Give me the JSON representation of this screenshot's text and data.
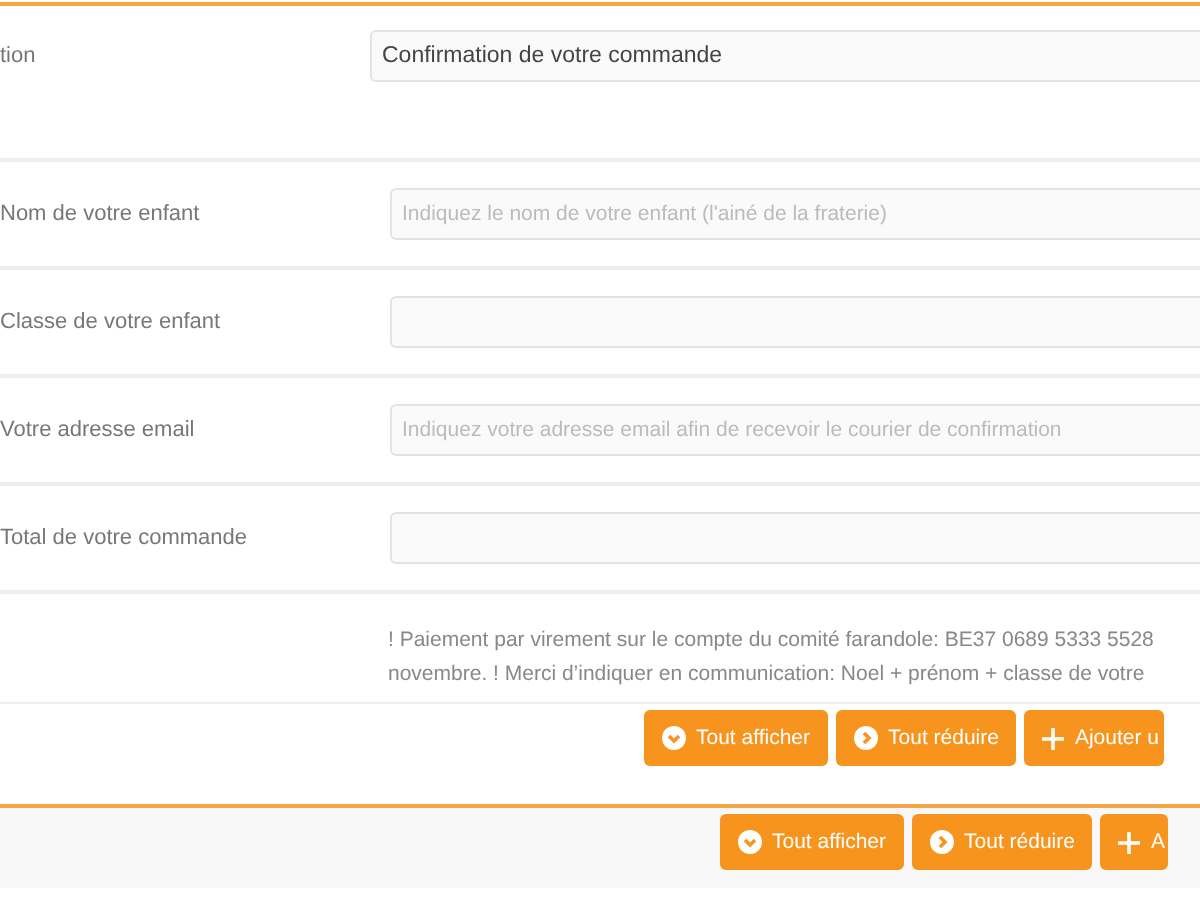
{
  "header_row": {
    "label": "tion",
    "value": "Confirmation de votre commande"
  },
  "fields": [
    {
      "label": "Nom de votre enfant",
      "placeholder": "Indiquez le nom de votre enfant (l'ainé de la fraterie)"
    },
    {
      "label": "Classe de votre enfant"
    },
    {
      "label": "Votre adresse email",
      "placeholder": "Indiquez votre adresse email afin de recevoir le courier de confirmation"
    },
    {
      "label": "Total de votre commande"
    }
  ],
  "notice_lines": [
    "! Paiement par virement sur le compte du comité farandole: BE37 0689 5333 5528",
    "novembre. ! Merci d’indiquer en communication: Noel + prénom + classe de votre"
  ],
  "inner_buttons": [
    {
      "kind": "expand",
      "label": "Tout afficher"
    },
    {
      "kind": "collapse",
      "label": "Tout réduire"
    },
    {
      "kind": "add",
      "label": "Ajouter u"
    }
  ],
  "footer_buttons": [
    {
      "kind": "expand",
      "label": "Tout afficher"
    },
    {
      "kind": "collapse",
      "label": "Tout réduire"
    },
    {
      "kind": "add",
      "label": "A"
    }
  ]
}
